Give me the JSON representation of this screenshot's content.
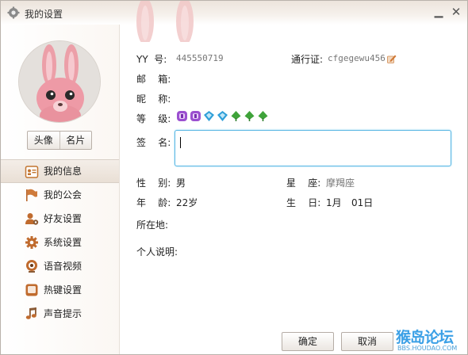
{
  "window": {
    "title": "我的设置",
    "minimize_glyph": "▁",
    "close_glyph": "✕"
  },
  "sidebar": {
    "avatar_buttons": [
      {
        "label": "头像"
      },
      {
        "label": "名片"
      }
    ],
    "items": [
      {
        "label": "我的信息",
        "icon": "profile-card-icon",
        "active": true
      },
      {
        "label": "我的公会",
        "icon": "flag-icon",
        "active": false
      },
      {
        "label": "好友设置",
        "icon": "friend-settings-icon",
        "active": false
      },
      {
        "label": "系统设置",
        "icon": "gear-icon",
        "active": false
      },
      {
        "label": "语音视频",
        "icon": "webcam-icon",
        "active": false
      },
      {
        "label": "热键设置",
        "icon": "hotkey-icon",
        "active": false
      },
      {
        "label": "声音提示",
        "icon": "music-note-icon",
        "active": false
      }
    ]
  },
  "profile": {
    "yy_label": "YY  号:",
    "yy_value": "445550719",
    "passport_label": "通行证:",
    "passport_value": "cfgegewu456",
    "email_label": "邮    箱:",
    "nickname_label": "昵    称:",
    "level_label": "等    级:",
    "level_icons": [
      "purple-badge",
      "purple-badge",
      "blue-diamond",
      "blue-diamond",
      "green-leaf",
      "green-leaf",
      "green-leaf"
    ],
    "signature_label": "签    名:",
    "signature_value": "",
    "gender_label": "性    别:",
    "gender_value": "男",
    "zodiac_label": "星    座:",
    "zodiac_value": "摩羯座",
    "age_label": "年    龄:",
    "age_value": "22岁",
    "birthday_label": "生    日:",
    "birthday_month": "1月",
    "birthday_day": "01日",
    "location_label": "所在地:",
    "bio_label": "个人说明:"
  },
  "footer": {
    "ok_label": "确定",
    "cancel_label": "取消"
  },
  "watermark": {
    "main": "猴岛论坛",
    "sub": "BBS.HOUDAO.COM"
  },
  "colors": {
    "accent_border": "#59b7e4",
    "sidebar_active": "#e9dfd5"
  }
}
